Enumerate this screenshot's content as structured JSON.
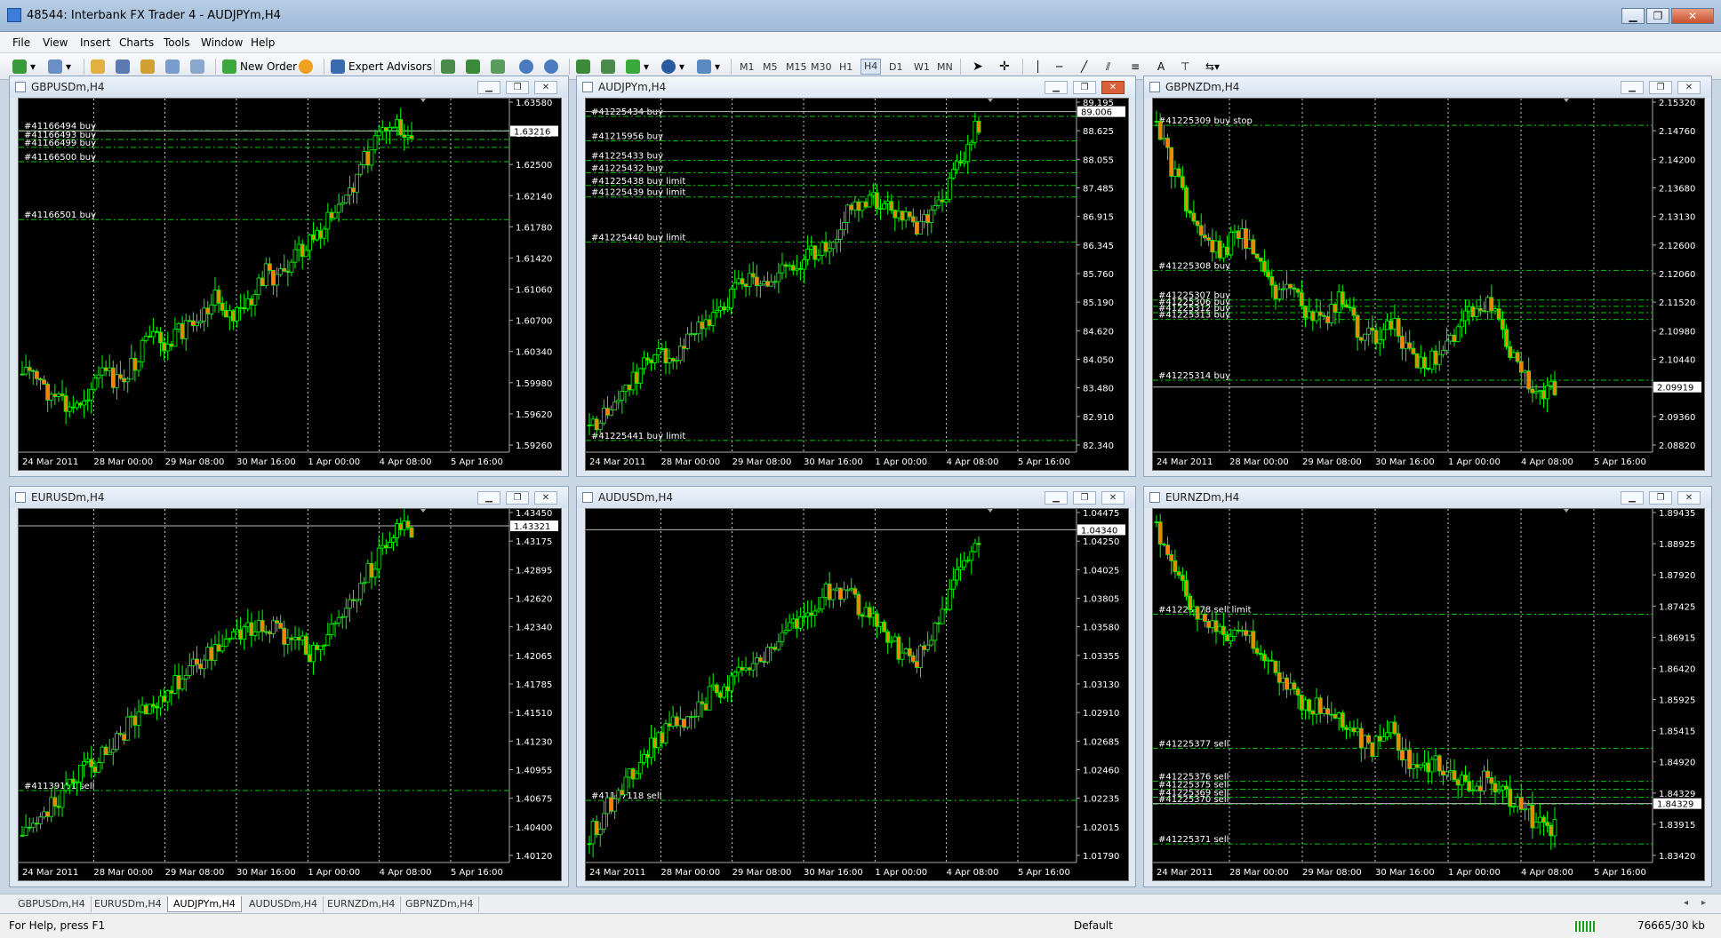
{
  "app": {
    "title": "48544: Interbank FX Trader 4 - AUDJPYm,H4"
  },
  "menu": [
    "File",
    "View",
    "Insert",
    "Charts",
    "Tools",
    "Window",
    "Help"
  ],
  "toolbar": {
    "new_order": "New Order",
    "expert_advisors": "Expert Advisors",
    "timeframes": [
      "M1",
      "M5",
      "M15",
      "M30",
      "H1",
      "H4",
      "D1",
      "W1",
      "MN"
    ],
    "active_timeframe": "H4"
  },
  "colors": {
    "bull": "#00ff00",
    "bear": "#ff7f00",
    "background": "#000000",
    "grid": "#ffffff",
    "order_line": "#00c800"
  },
  "windows": [
    {
      "title": "GBPUSDm,H4",
      "price": "1.63216",
      "ticks": [
        "1.63580",
        "1.62860",
        "1.62500",
        "1.62140",
        "1.61780",
        "1.61420",
        "1.61060",
        "1.60700",
        "1.60340",
        "1.59980",
        "1.59620",
        "1.59260"
      ],
      "dates": [
        "24 Mar 2011",
        "28 Mar 00:00",
        "29 Mar 08:00",
        "30 Mar 16:00",
        "1 Apr 00:00",
        "4 Apr 08:00",
        "5 Apr 16:00"
      ],
      "orders": [
        {
          "label": "#41166494 buy",
          "price": 1.6322
        },
        {
          "label": "#41166493 buy",
          "price": 1.6311
        },
        {
          "label": "#41166499 buy",
          "price": 1.6301
        },
        {
          "label": "#41166500 buy",
          "price": 1.6283
        },
        {
          "label": "#41166501 buy",
          "price": 1.621
        }
      ]
    },
    {
      "title": "AUDJPYm,H4",
      "price": "89.006",
      "ticks": [
        "89.195",
        "88.625",
        "88.055",
        "87.485",
        "86.915",
        "86.345",
        "85.760",
        "85.190",
        "84.620",
        "84.050",
        "83.480",
        "82.910",
        "82.340"
      ],
      "dates": [
        "24 Mar 2011",
        "28 Mar 00:00",
        "29 Mar 08:00",
        "30 Mar 16:00",
        "1 Apr 00:00",
        "4 Apr 08:00",
        "5 Apr 16:00"
      ],
      "orders": [
        {
          "label": "#41225434 buy",
          "price": 88.91
        },
        {
          "label": "#41215956 buy",
          "price": 88.42
        },
        {
          "label": "#41225433 buy",
          "price": 88.03
        },
        {
          "label": "#41225432 buy",
          "price": 87.78
        },
        {
          "label": "#41225438 buy limit",
          "price": 87.53
        },
        {
          "label": "#41225439 buy limit",
          "price": 87.3
        },
        {
          "label": "#41225440 buy limit",
          "price": 86.4
        },
        {
          "label": "#41225441 buy limit",
          "price": 82.43
        }
      ]
    },
    {
      "title": "GBPNZDm,H4",
      "price": "2.09919",
      "ticks": [
        "2.15320",
        "2.14760",
        "2.14200",
        "2.13680",
        "2.13130",
        "2.12600",
        "2.12060",
        "2.11520",
        "2.10980",
        "2.10440",
        "2.09880",
        "2.09360",
        "2.08820"
      ],
      "dates": [
        "24 Mar 2011",
        "28 Mar 00:00",
        "29 Mar 08:00",
        "30 Mar 16:00",
        "1 Apr 00:00",
        "4 Apr 08:00",
        "5 Apr 16:00"
      ],
      "orders": [
        {
          "label": "#41225309 buy stop",
          "price": 2.1488
        },
        {
          "label": "#41225308 buy",
          "price": 2.1213
        },
        {
          "label": "#41225307 buy",
          "price": 2.1157
        },
        {
          "label": "#41225306 buy",
          "price": 2.1145
        },
        {
          "label": "#41225312 buy",
          "price": 2.1133
        },
        {
          "label": "#41225313 buy",
          "price": 2.112
        },
        {
          "label": "#41225314 buy",
          "price": 2.1005
        }
      ]
    },
    {
      "title": "EURUSDm,H4",
      "price": "1.43321",
      "ticks": [
        "1.43450",
        "1.43175",
        "1.42895",
        "1.42620",
        "1.42340",
        "1.42065",
        "1.41785",
        "1.41510",
        "1.41230",
        "1.40955",
        "1.40675",
        "1.40400",
        "1.40120"
      ],
      "dates": [
        "24 Mar 2011",
        "28 Mar 00:00",
        "29 Mar 08:00",
        "30 Mar 16:00",
        "1 Apr 00:00",
        "4 Apr 08:00",
        "5 Apr 16:00"
      ],
      "orders": [
        {
          "label": "#41139151 sell",
          "price": 1.4075
        }
      ]
    },
    {
      "title": "AUDUSDm,H4",
      "price": "1.04340",
      "ticks": [
        "1.04475",
        "1.04250",
        "1.04025",
        "1.03805",
        "1.03580",
        "1.03355",
        "1.03130",
        "1.02910",
        "1.02685",
        "1.02460",
        "1.02235",
        "1.02015",
        "1.01790"
      ],
      "dates": [
        "24 Mar 2011",
        "28 Mar 00:00",
        "29 Mar 08:00",
        "30 Mar 16:00",
        "1 Apr 00:00",
        "4 Apr 08:00",
        "5 Apr 16:00"
      ],
      "orders": [
        {
          "label": "#41167118 sell",
          "price": 1.0222
        }
      ]
    },
    {
      "title": "EURNZDm,H4",
      "price": "1.84329",
      "ticks": [
        "1.89435",
        "1.88925",
        "1.87920",
        "1.87425",
        "1.86915",
        "1.86420",
        "1.85925",
        "1.85415",
        "1.84920",
        "1.84329",
        "1.83915",
        "1.83420"
      ],
      "dates": [
        "24 Mar 2011",
        "28 Mar 00:00",
        "29 Mar 08:00",
        "30 Mar 16:00",
        "1 Apr 00:00",
        "4 Apr 08:00",
        "5 Apr 16:00"
      ],
      "orders": [
        {
          "label": "#41225378 sell limit",
          "price": 1.8765
        },
        {
          "label": "#41225377 sell",
          "price": 1.853
        },
        {
          "label": "#41225376 sell",
          "price": 1.8472
        },
        {
          "label": "#41225375 sell",
          "price": 1.8458
        },
        {
          "label": "#41225369 sell",
          "price": 1.8444
        },
        {
          "label": "#41225370 sell",
          "price": 1.8432
        },
        {
          "label": "#41225371 sell",
          "price": 1.8362
        }
      ]
    }
  ],
  "tabs": [
    "GBPUSDm,H4",
    "EURUSDm,H4",
    "AUDJPYm,H4",
    "AUDUSDm,H4",
    "EURNZDm,H4",
    "GBPNZDm,H4"
  ],
  "active_tab": "AUDJPYm,H4",
  "status": {
    "help": "For Help, press F1",
    "profile": "Default",
    "traffic": "76665/30 kb"
  }
}
